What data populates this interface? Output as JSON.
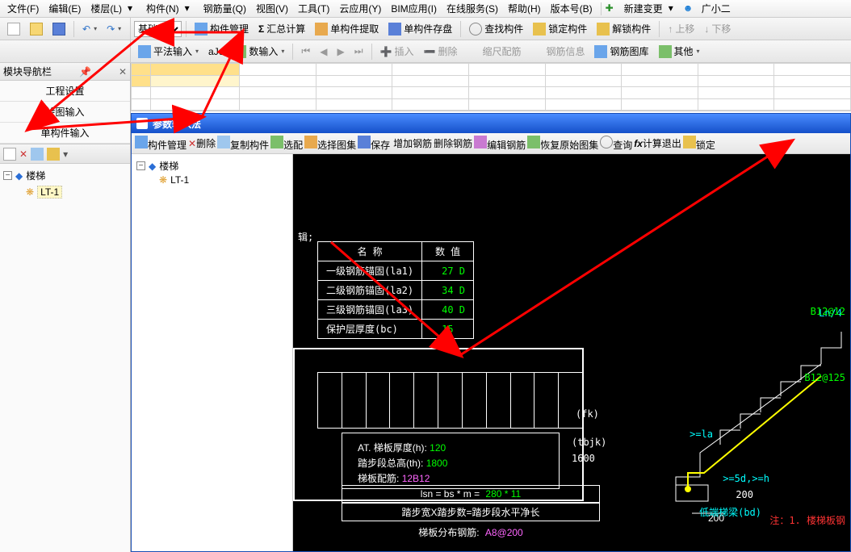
{
  "menu": {
    "file": "文件(F)",
    "edit": "编辑(E)",
    "floor": "楼层(L)",
    "component": "构件(N)",
    "rebar": "钢筋量(Q)",
    "view": "视图(V)",
    "tool": "工具(T)",
    "cloud": "云应用(Y)",
    "bim": "BIM应用(I)",
    "online": "在线服务(S)",
    "help": "帮助(H)",
    "version": "版本号(B)",
    "newchange": "新建变更",
    "assistant": "广小二"
  },
  "tb1": {
    "undo": "↶",
    "redo": "↷",
    "floorLevel": "基础层",
    "compMgr": "构件管理",
    "sumCalc": "汇总计算",
    "singleExtract": "单构件提取",
    "singleSave": "单构件存盘",
    "findComp": "查找构件",
    "lockComp": "锁定构件",
    "unlockComp": "解锁构件",
    "moveUp": "上移",
    "moveDown": "下移"
  },
  "tb2": {
    "pingfa": "平法输入",
    "ale": "aJe",
    "inputMethod": "数输入",
    "insert": "插入",
    "delete": "删除",
    "scaleRebar": "缩尺配筋",
    "rebarInfo": "钢筋信息",
    "rebarLib": "钢筋图库",
    "other": "其他"
  },
  "left": {
    "title": "模块导航栏",
    "nav": {
      "projSetting": "工程设置",
      "drawInput": "绘图输入",
      "singleInput": "单构件输入"
    },
    "tree": {
      "root": "楼梯",
      "child": "LT-1"
    }
  },
  "bluewin": {
    "title": "参数输入法",
    "tb": {
      "compMgr": "构件管理",
      "delete": "删除",
      "copyComp": "复制构件",
      "select": "选配",
      "chooseAtlas": "选择图集",
      "save": "保存",
      "addRebar": "增加钢筋",
      "delRebar": "删除钢筋",
      "editRebar": "编辑钢筋",
      "restoreAtlas": "恢复原始图集",
      "query": "查询",
      "calcExit": "计算退出",
      "lock": "锁定"
    },
    "tree": {
      "root": "楼梯",
      "child": "LT-1"
    }
  },
  "cad": {
    "paramHeader": {
      "name": "名 称",
      "value": "数 值"
    },
    "params": [
      {
        "label": "一级钢筋锚固(la1)",
        "value": "27 D"
      },
      {
        "label": "二级钢筋锚固(la2)",
        "value": "34 D"
      },
      {
        "label": "三级钢筋锚固(la3)",
        "value": "40 D"
      },
      {
        "label": "保护层厚度(bc)",
        "value": "15"
      }
    ],
    "stairLines": {
      "l1a": "AT. 梯板厚度(h):",
      "l1v": "120",
      "l2a": "踏步段总高(th):",
      "l2v": "1800",
      "l3a": "梯板配筋:",
      "l3v": "12B12"
    },
    "dimLsn": "lsn = bs * m =",
    "dimLsnV": "280 * 11",
    "bottom1a": "踏步宽X踏步数=",
    "bottom1b": "踏步段水平净长",
    "bottom2a": "梯板分布钢筋:",
    "bottom2b": "A8@200",
    "fk": "(fk)",
    "tbjk": "(tbjk)",
    "v1600": "1600",
    "lnq": "Ln/4",
    "b12012": "B12@12",
    "b120125": "B12@125",
    "gla": ">=la",
    "g5d": ">=5d,>=h",
    "d200": "200",
    "bdLabel": "低端梯梁(bd)",
    "note": "注：1. 楼梯板钢"
  }
}
